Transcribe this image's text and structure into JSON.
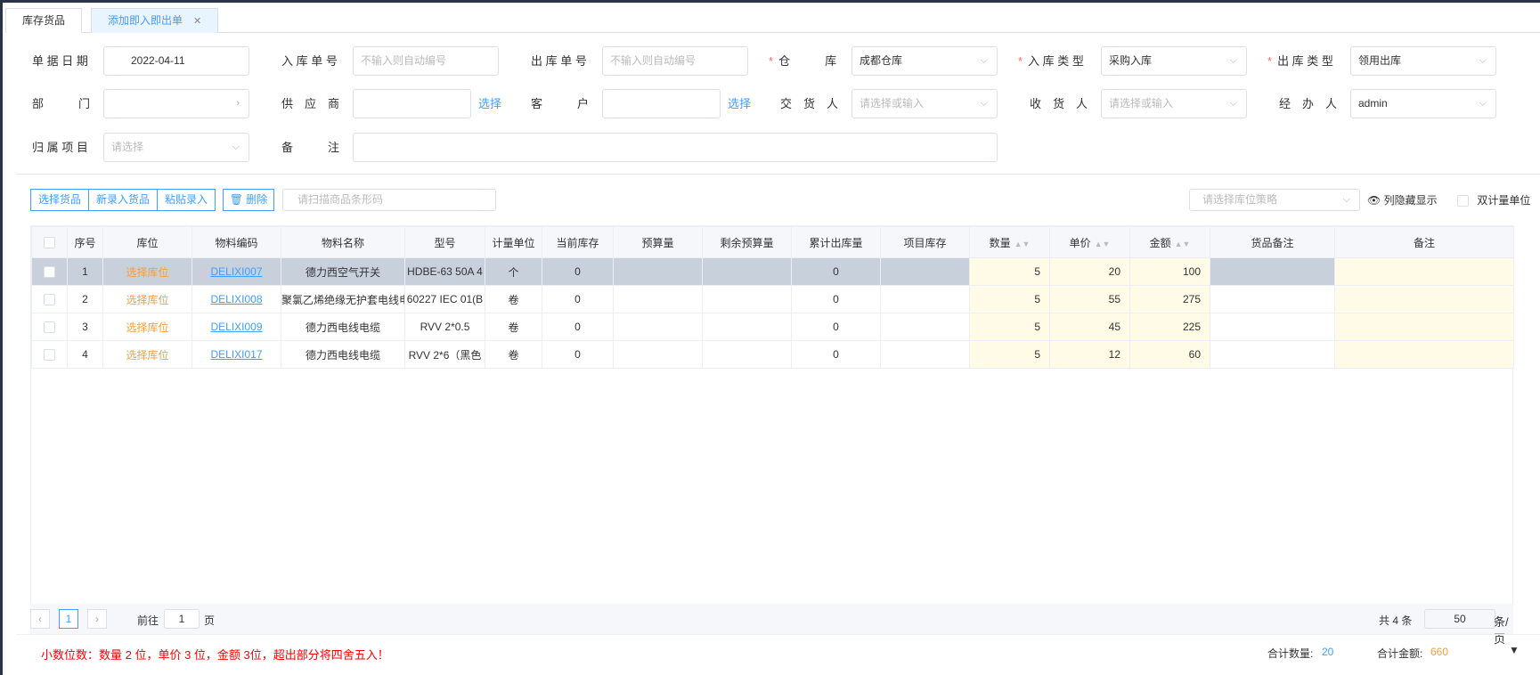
{
  "tabs": [
    {
      "label": "库存货品"
    },
    {
      "label": "添加即入即出单"
    }
  ],
  "form": {
    "date_label": "单 据 日 期",
    "date_value": "2022-04-11",
    "in_no_label": "入 库 单 号",
    "in_no_ph": "不输入则自动编号",
    "out_no_label": "出 库 单 号",
    "out_no_ph": "不输入则自动编号",
    "wh_label": "仓　　　库",
    "wh_value": "成都仓库",
    "in_type_label": "入 库 类 型",
    "in_type_value": "采购入库",
    "out_type_label": "出 库 类 型",
    "out_type_value": "领用出库",
    "dept_label": "部　　　门",
    "supplier_label": "供　应　商",
    "supplier_link": "选择",
    "customer_label": "客　　　户",
    "customer_link": "选择",
    "deliverer_label": "交　货　人",
    "deliverer_ph": "请选择或输入",
    "receiver_label": "收　货　人",
    "receiver_ph": "请选择或输入",
    "handler_label": "经　办　人",
    "handler_value": "admin",
    "project_label": "归 属 项 目",
    "project_ph": "请选择",
    "remark_label": "备　　　注"
  },
  "toolbar": {
    "select_goods": "选择货品",
    "new_goods": "新录入货品",
    "paste": "粘贴录入",
    "delete": "删除",
    "scan_ph": "请扫描商品条形码",
    "loc_strategy_ph": "请选择库位策略",
    "col_toggle": "列隐藏显示",
    "dual_unit": "双计量单位"
  },
  "table": {
    "headers": [
      "序号",
      "库位",
      "物料编码",
      "物料名称",
      "型号",
      "计量单位",
      "当前库存",
      "预算量",
      "剩余预算量",
      "累计出库量",
      "项目库存",
      "数量",
      "单价",
      "金额",
      "货品备注",
      "备注"
    ],
    "rows": [
      {
        "no": "1",
        "loc": "选择库位",
        "code": "DELIXI007",
        "name": "德力西空气开关",
        "model": "HDBE-63 50A 4",
        "unit": "个",
        "stock": "0",
        "out": "0",
        "qty": "5",
        "price": "20",
        "amount": "100"
      },
      {
        "no": "2",
        "loc": "选择库位",
        "code": "DELIXI008",
        "name": "聚氯乙烯绝缘无护套电线电",
        "model": "60227 IEC 01(B",
        "unit": "卷",
        "stock": "0",
        "out": "0",
        "qty": "5",
        "price": "55",
        "amount": "275"
      },
      {
        "no": "3",
        "loc": "选择库位",
        "code": "DELIXI009",
        "name": "德力西电线电缆",
        "model": "RVV 2*0.5",
        "unit": "卷",
        "stock": "0",
        "out": "0",
        "qty": "5",
        "price": "45",
        "amount": "225"
      },
      {
        "no": "4",
        "loc": "选择库位",
        "code": "DELIXI017",
        "name": "德力西电线电缆",
        "model": "RVV 2*6（黑色",
        "unit": "卷",
        "stock": "0",
        "out": "0",
        "qty": "5",
        "price": "12",
        "amount": "60"
      }
    ]
  },
  "pager": {
    "page": "1",
    "goto_label": "前往",
    "goto_value": "1",
    "page_unit": "页",
    "total": "共 4 条",
    "size": "50",
    "size_unit": "条/页"
  },
  "footer": {
    "note": "小数位数：数量 2 位，单价 3 位，金额 3位，超出部分将四舍五入！",
    "total_qty_label": "合计数量:",
    "total_qty": "20",
    "total_amount_label": "合计金额:",
    "total_amount": "660"
  }
}
